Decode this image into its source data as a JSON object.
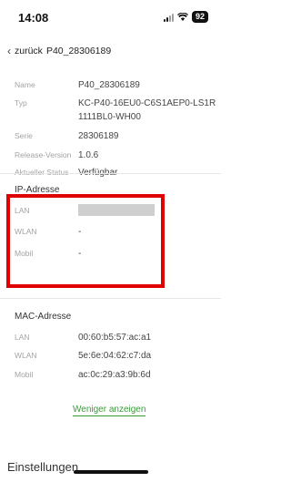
{
  "status_bar": {
    "time": "14:08",
    "battery": "92"
  },
  "nav": {
    "back_label": "zurück",
    "title": "P40_28306189"
  },
  "device_info": [
    {
      "label": "Name",
      "value": "P40_28306189"
    },
    {
      "label": "Typ",
      "value": "KC-P40-16EU0-C6S1AEP0-LS1R1111BL0-WH00"
    },
    {
      "label": "Serie",
      "value": "28306189"
    },
    {
      "label": "Release-Version",
      "value": "1.0.6"
    },
    {
      "label": "Aktueller Status",
      "value": "Verfügbar"
    }
  ],
  "ip_section": {
    "title": "IP-Adresse",
    "rows": [
      {
        "label": "LAN",
        "value": ""
      },
      {
        "label": "WLAN",
        "value": "-"
      },
      {
        "label": "Mobil",
        "value": "-"
      }
    ]
  },
  "mac_section": {
    "title": "MAC-Adresse",
    "rows": [
      {
        "label": "LAN",
        "value": "00:60:b5:57:ac:a1"
      },
      {
        "label": "WLAN",
        "value": "5e:6e:04:62:c7:da"
      },
      {
        "label": "Mobil",
        "value": "ac:0c:29:a3:9b:6d"
      }
    ]
  },
  "show_less_label": "Weniger anzeigen",
  "settings_label": "Einstellungen",
  "colors": {
    "highlight": "#e00000",
    "link": "#3a9a3a"
  }
}
